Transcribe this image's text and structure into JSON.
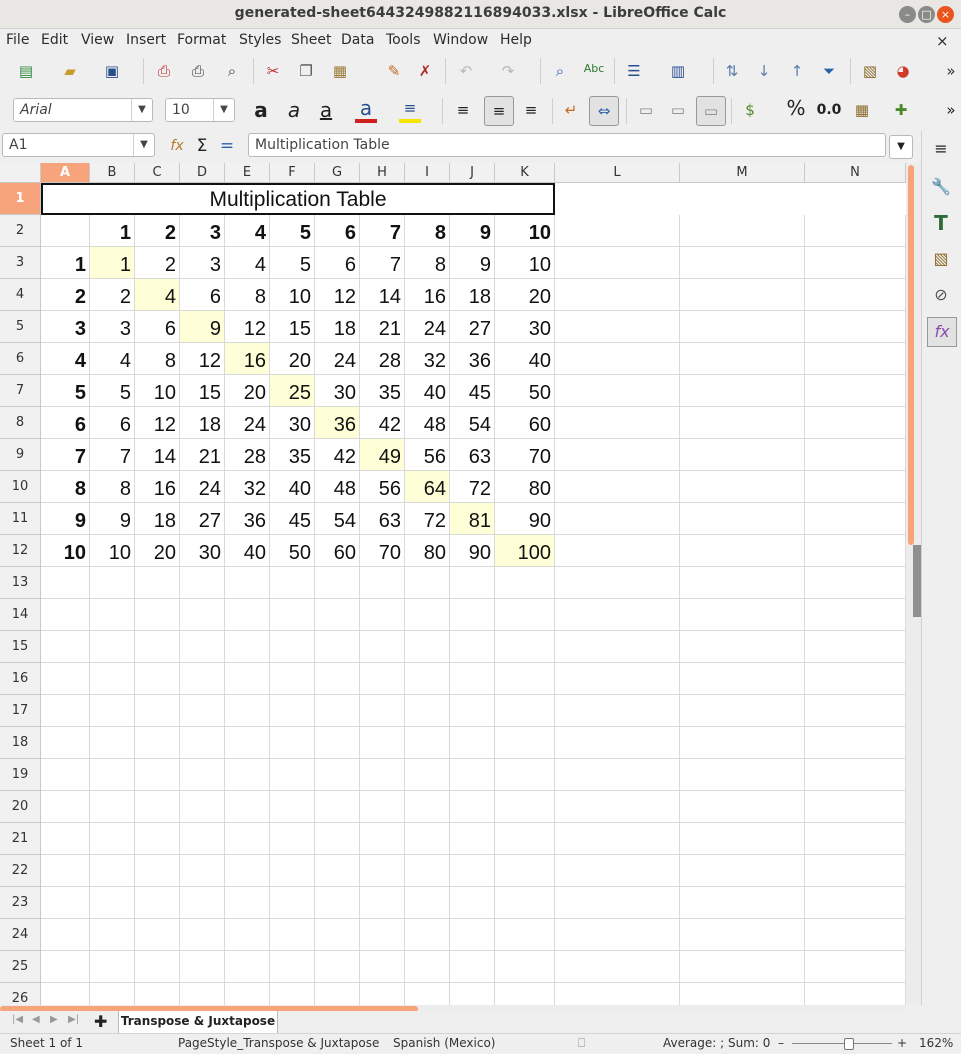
{
  "window": {
    "title": "generated-sheet6443249882116894033.xlsx - LibreOffice Calc"
  },
  "menu": [
    "File",
    "Edit",
    "View",
    "Insert",
    "Format",
    "Styles",
    "Sheet",
    "Data",
    "Tools",
    "Window",
    "Help"
  ],
  "format_toolbar": {
    "font_name": "Arial",
    "font_size": "10",
    "number_format": "0.0"
  },
  "formula_bar": {
    "cell_ref": "A1",
    "content": "Multiplication Table"
  },
  "columns": [
    "A",
    "B",
    "C",
    "D",
    "E",
    "F",
    "G",
    "H",
    "I",
    "J",
    "K",
    "L",
    "M",
    "N"
  ],
  "selected_column": "A",
  "row_numbers": [
    "1",
    "2",
    "3",
    "4",
    "5",
    "6",
    "7",
    "8",
    "9",
    "10",
    "11",
    "12",
    "13",
    "14",
    "15",
    "16",
    "17",
    "18",
    "19",
    "20",
    "21",
    "22",
    "23",
    "24",
    "25",
    "26"
  ],
  "sheet": {
    "title": "Multiplication Table",
    "header_row": [
      "1",
      "2",
      "3",
      "4",
      "5",
      "6",
      "7",
      "8",
      "9",
      "10"
    ],
    "rows": [
      {
        "label": "1",
        "values": [
          "1",
          "2",
          "3",
          "4",
          "5",
          "6",
          "7",
          "8",
          "9",
          "10"
        ]
      },
      {
        "label": "2",
        "values": [
          "2",
          "4",
          "6",
          "8",
          "10",
          "12",
          "14",
          "16",
          "18",
          "20"
        ]
      },
      {
        "label": "3",
        "values": [
          "3",
          "6",
          "9",
          "12",
          "15",
          "18",
          "21",
          "24",
          "27",
          "30"
        ]
      },
      {
        "label": "4",
        "values": [
          "4",
          "8",
          "12",
          "16",
          "20",
          "24",
          "28",
          "32",
          "36",
          "40"
        ]
      },
      {
        "label": "5",
        "values": [
          "5",
          "10",
          "15",
          "20",
          "25",
          "30",
          "35",
          "40",
          "45",
          "50"
        ]
      },
      {
        "label": "6",
        "values": [
          "6",
          "12",
          "18",
          "24",
          "30",
          "36",
          "42",
          "48",
          "54",
          "60"
        ]
      },
      {
        "label": "7",
        "values": [
          "7",
          "14",
          "21",
          "28",
          "35",
          "42",
          "49",
          "56",
          "63",
          "70"
        ]
      },
      {
        "label": "8",
        "values": [
          "8",
          "16",
          "24",
          "32",
          "40",
          "48",
          "56",
          "64",
          "72",
          "80"
        ]
      },
      {
        "label": "9",
        "values": [
          "9",
          "18",
          "27",
          "36",
          "45",
          "54",
          "63",
          "72",
          "81",
          "90"
        ]
      },
      {
        "label": "10",
        "values": [
          "10",
          "20",
          "30",
          "40",
          "50",
          "60",
          "70",
          "80",
          "90",
          "100"
        ]
      }
    ],
    "diagonal_highlight_color": "#ffffd7"
  },
  "tabs": {
    "active": "Transpose & Juxtapose"
  },
  "status": {
    "sheet": "Sheet 1 of 1",
    "page_style": "PageStyle_Transpose & Juxtapose",
    "language": "Spanish (Mexico)",
    "summary": "Average: ; Sum: 0",
    "zoom": "162%"
  },
  "colors": {
    "accent": "#f7a37c",
    "selected_header": "#f7a37c"
  }
}
